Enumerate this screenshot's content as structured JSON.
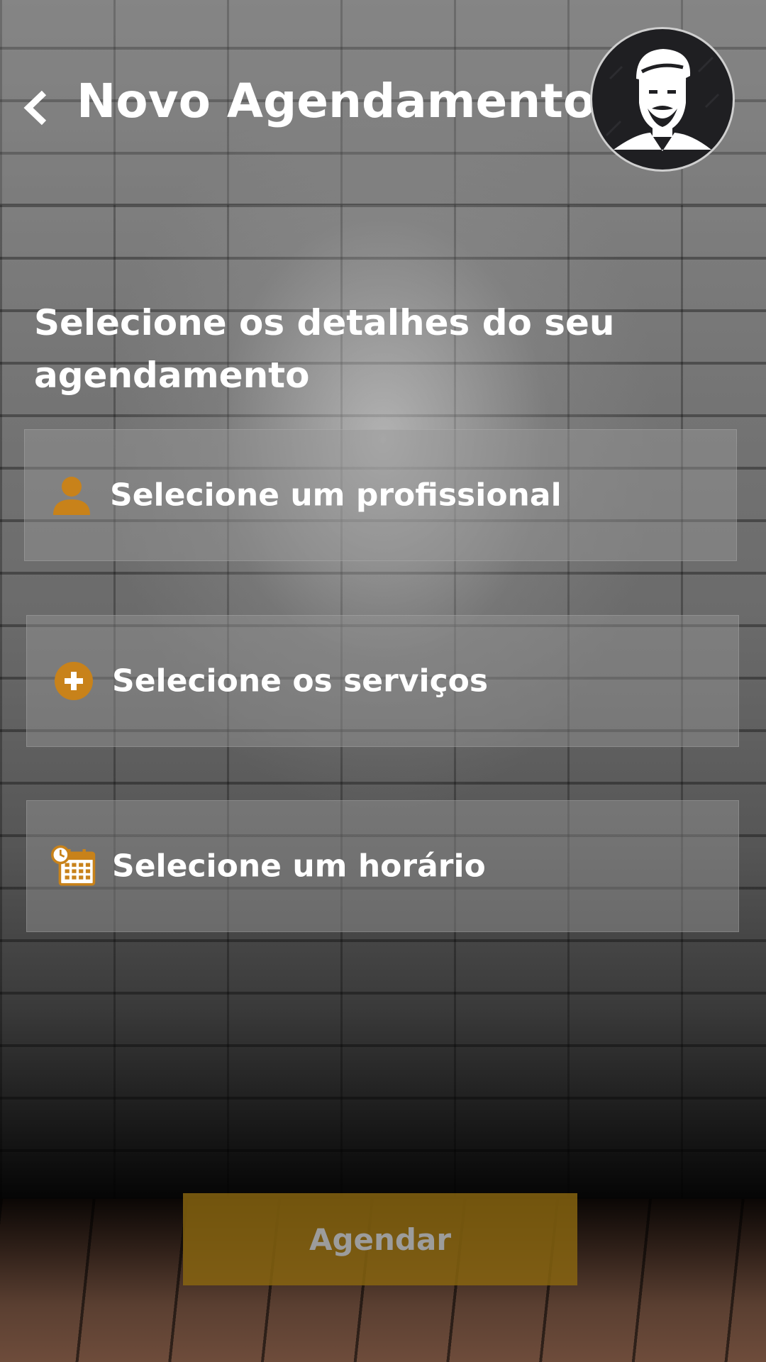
{
  "header": {
    "title": "Novo Agendamento",
    "back_icon": "chevron-left-icon",
    "avatar_icon": "barber-avatar-icon"
  },
  "main": {
    "subtitle": "Selecione os detalhes do seu agendamento",
    "options": [
      {
        "label": "Selecione um profissional",
        "icon": "person-icon"
      },
      {
        "label": "Selecione os serviços",
        "icon": "plus-circle-icon"
      },
      {
        "label": "Selecione um horário",
        "icon": "calendar-clock-icon"
      }
    ],
    "submit_label": "Agendar"
  },
  "colors": {
    "accent": "#C8821A",
    "submit_bg": "#8A6610",
    "text": "#FFFFFF",
    "submit_text": "#9C9C9C"
  }
}
